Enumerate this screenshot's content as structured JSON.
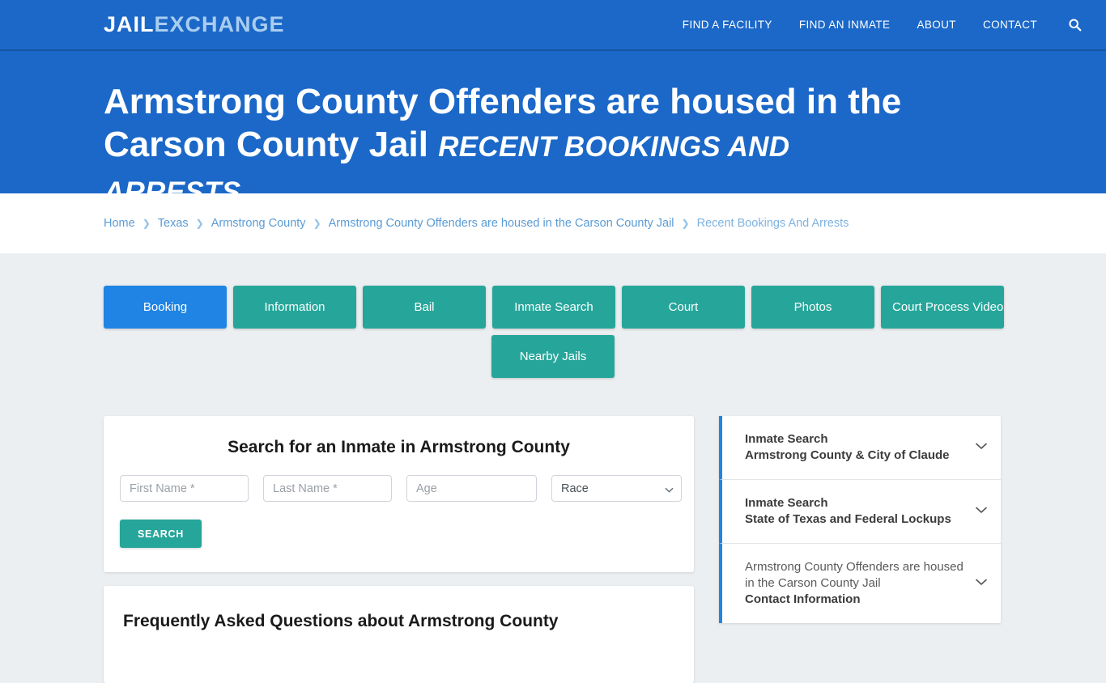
{
  "header": {
    "logo_primary": "JAIL",
    "logo_secondary": "EXCHANGE",
    "nav": [
      {
        "label": "FIND A FACILITY"
      },
      {
        "label": "FIND AN INMATE"
      },
      {
        "label": "ABOUT"
      },
      {
        "label": "CONTACT"
      }
    ],
    "search_icon": "search-icon",
    "title_main": "Armstrong County Offenders are housed in the Carson County Jail ",
    "title_sub": "RECENT BOOKINGS AND ARRESTS",
    "bg_color": "#1b68c8"
  },
  "breadcrumb": {
    "separator": "❯",
    "items": [
      {
        "label": "Home"
      },
      {
        "label": "Texas"
      },
      {
        "label": "Armstrong County"
      },
      {
        "label": "Armstrong County Offenders are housed in the Carson County Jail"
      },
      {
        "label": "Recent Bookings And Arrests"
      }
    ]
  },
  "tabs": {
    "row1": [
      {
        "label": "Booking",
        "active": true
      },
      {
        "label": "Information",
        "active": false
      },
      {
        "label": "Bail",
        "active": false
      },
      {
        "label": "Inmate Search",
        "active": false
      },
      {
        "label": "Court",
        "active": false
      },
      {
        "label": "Photos",
        "active": false
      },
      {
        "label": "Court Process Video",
        "active": false
      }
    ],
    "row2": [
      {
        "label": "Nearby Jails",
        "active": false
      }
    ],
    "active_color": "#2084e4",
    "inactive_color": "#26a69a"
  },
  "search_panel": {
    "title": "Search for an Inmate in Armstrong County",
    "first_name_placeholder": "First Name *",
    "last_name_placeholder": "Last Name *",
    "age_placeholder": "Age",
    "first_name_value": "",
    "last_name_value": "",
    "age_value": "",
    "race_selected": "Race",
    "race_options": [
      "Race"
    ],
    "submit_label": "SEARCH"
  },
  "faq": {
    "title": "Frequently Asked Questions about Armstrong County"
  },
  "sidebar": {
    "items": [
      {
        "line1": "Inmate Search",
        "line2": "Armstrong County & City of Claude",
        "style": "bold",
        "icon": "chevron-down-icon"
      },
      {
        "line1": "Inmate Search",
        "line2": "State of Texas and Federal Lockups",
        "style": "bold",
        "icon": "chevron-down-icon"
      },
      {
        "line1": "Armstrong County Offenders are housed in the Carson County Jail",
        "line2": "Contact Information",
        "style": "plain",
        "icon": "chevron-down-icon"
      }
    ],
    "accent_color": "#2084e4"
  }
}
